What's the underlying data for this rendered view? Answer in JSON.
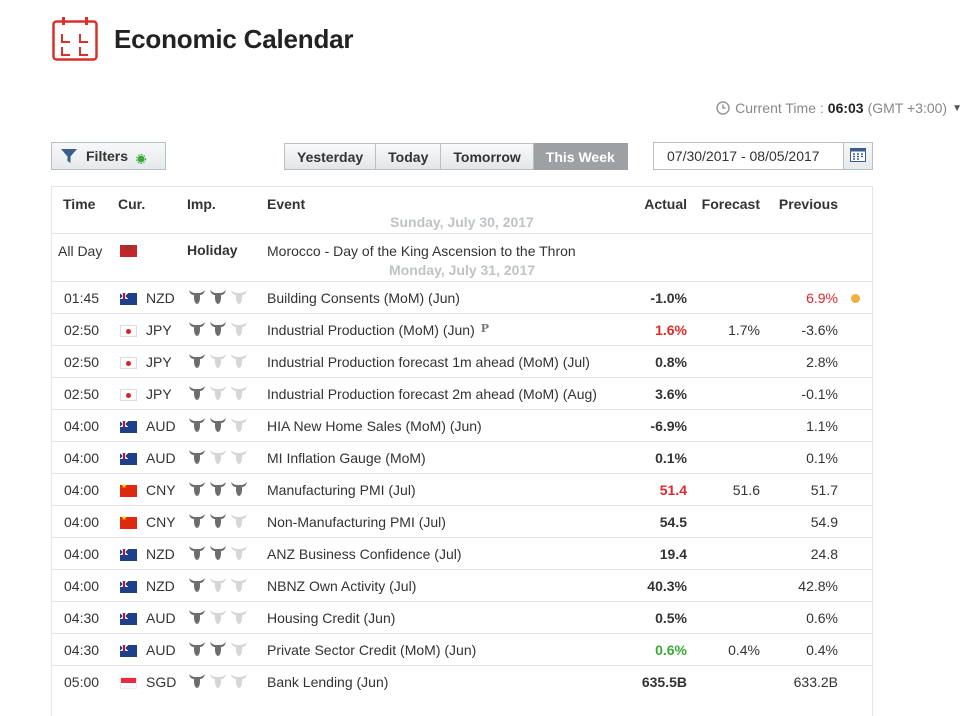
{
  "header": {
    "title": "Economic Calendar"
  },
  "current_time": {
    "label": "Current Time :",
    "time": "06:03",
    "timezone": "(GMT +3:00)"
  },
  "filters": {
    "label": "Filters"
  },
  "day_tabs": [
    "Yesterday",
    "Today",
    "Tomorrow",
    "This Week"
  ],
  "active_tab": "This Week",
  "date_range": "07/30/2017 - 08/05/2017",
  "columns": {
    "time": "Time",
    "cur": "Cur.",
    "imp": "Imp.",
    "event": "Event",
    "actual": "Actual",
    "forecast": "Forecast",
    "previous": "Previous"
  },
  "days": {
    "d1": "Sunday, July 30, 2017",
    "d2": "Monday, July 31, 2017"
  },
  "holiday_row": {
    "time": "All Day",
    "country": "Morocco",
    "label": "Holiday",
    "event": "Morocco - Day of the King Ascension to the Thron"
  },
  "colors": {
    "negative": "#e02a2a",
    "positive": "#3aa935",
    "active_tab_bg": "#9da1a4",
    "alert_dot": "#f0b23c",
    "logo_red": "#d9302c"
  },
  "rows": [
    {
      "time": "01:45",
      "flag": "nz",
      "cur": "NZD",
      "imp": 2,
      "event": "Building Consents (MoM) (Jun)",
      "actual": "-1.0%",
      "actual_style": "",
      "forecast": "",
      "previous": "6.9%",
      "previous_style": "neg",
      "alert": true,
      "prelim": false
    },
    {
      "time": "02:50",
      "flag": "jp",
      "cur": "JPY",
      "imp": 2,
      "event": "Industrial Production (MoM) (Jun)",
      "actual": "1.6%",
      "actual_style": "neg",
      "forecast": "1.7%",
      "previous": "-3.6%",
      "previous_style": "",
      "alert": false,
      "prelim": true,
      "prelim_glyph": "P"
    },
    {
      "time": "02:50",
      "flag": "jp",
      "cur": "JPY",
      "imp": 1,
      "event": "Industrial Production forecast 1m ahead (MoM) (Jul)",
      "actual": "0.8%",
      "actual_style": "",
      "forecast": "",
      "previous": "2.8%",
      "previous_style": "",
      "alert": false,
      "prelim": false
    },
    {
      "time": "02:50",
      "flag": "jp",
      "cur": "JPY",
      "imp": 1,
      "event": "Industrial Production forecast 2m ahead (MoM) (Aug)",
      "actual": "3.6%",
      "actual_style": "",
      "forecast": "",
      "previous": "-0.1%",
      "previous_style": "",
      "alert": false,
      "prelim": false
    },
    {
      "time": "04:00",
      "flag": "au",
      "cur": "AUD",
      "imp": 2,
      "event": "HIA New Home Sales (MoM) (Jun)",
      "actual": "-6.9%",
      "actual_style": "",
      "forecast": "",
      "previous": "1.1%",
      "previous_style": "",
      "alert": false,
      "prelim": false
    },
    {
      "time": "04:00",
      "flag": "au",
      "cur": "AUD",
      "imp": 1,
      "event": "MI Inflation Gauge (MoM)",
      "actual": "0.1%",
      "actual_style": "",
      "forecast": "",
      "previous": "0.1%",
      "previous_style": "",
      "alert": false,
      "prelim": false
    },
    {
      "time": "04:00",
      "flag": "cn",
      "cur": "CNY",
      "imp": 3,
      "event": "Manufacturing PMI (Jul)",
      "actual": "51.4",
      "actual_style": "neg",
      "forecast": "51.6",
      "previous": "51.7",
      "previous_style": "",
      "alert": false,
      "prelim": false
    },
    {
      "time": "04:00",
      "flag": "cn",
      "cur": "CNY",
      "imp": 2,
      "event": "Non-Manufacturing PMI (Jul)",
      "actual": "54.5",
      "actual_style": "",
      "forecast": "",
      "previous": "54.9",
      "previous_style": "",
      "alert": false,
      "prelim": false
    },
    {
      "time": "04:00",
      "flag": "nz",
      "cur": "NZD",
      "imp": 2,
      "event": "ANZ Business Confidence (Jul)",
      "actual": "19.4",
      "actual_style": "",
      "forecast": "",
      "previous": "24.8",
      "previous_style": "",
      "alert": false,
      "prelim": false
    },
    {
      "time": "04:00",
      "flag": "nz",
      "cur": "NZD",
      "imp": 1,
      "event": "NBNZ Own Activity (Jul)",
      "actual": "40.3%",
      "actual_style": "",
      "forecast": "",
      "previous": "42.8%",
      "previous_style": "",
      "alert": false,
      "prelim": false
    },
    {
      "time": "04:30",
      "flag": "au",
      "cur": "AUD",
      "imp": 1,
      "event": "Housing Credit (Jun)",
      "actual": "0.5%",
      "actual_style": "",
      "forecast": "",
      "previous": "0.6%",
      "previous_style": "",
      "alert": false,
      "prelim": false
    },
    {
      "time": "04:30",
      "flag": "au",
      "cur": "AUD",
      "imp": 2,
      "event": "Private Sector Credit (MoM) (Jun)",
      "actual": "0.6%",
      "actual_style": "pos",
      "forecast": "0.4%",
      "previous": "0.4%",
      "previous_style": "",
      "alert": false,
      "prelim": false
    },
    {
      "time": "05:00",
      "flag": "sg",
      "cur": "SGD",
      "imp": 1,
      "event": "Bank Lending (Jun)",
      "actual": "635.5B",
      "actual_style": "",
      "forecast": "",
      "previous": "633.2B",
      "previous_style": "",
      "alert": false,
      "prelim": false
    }
  ]
}
